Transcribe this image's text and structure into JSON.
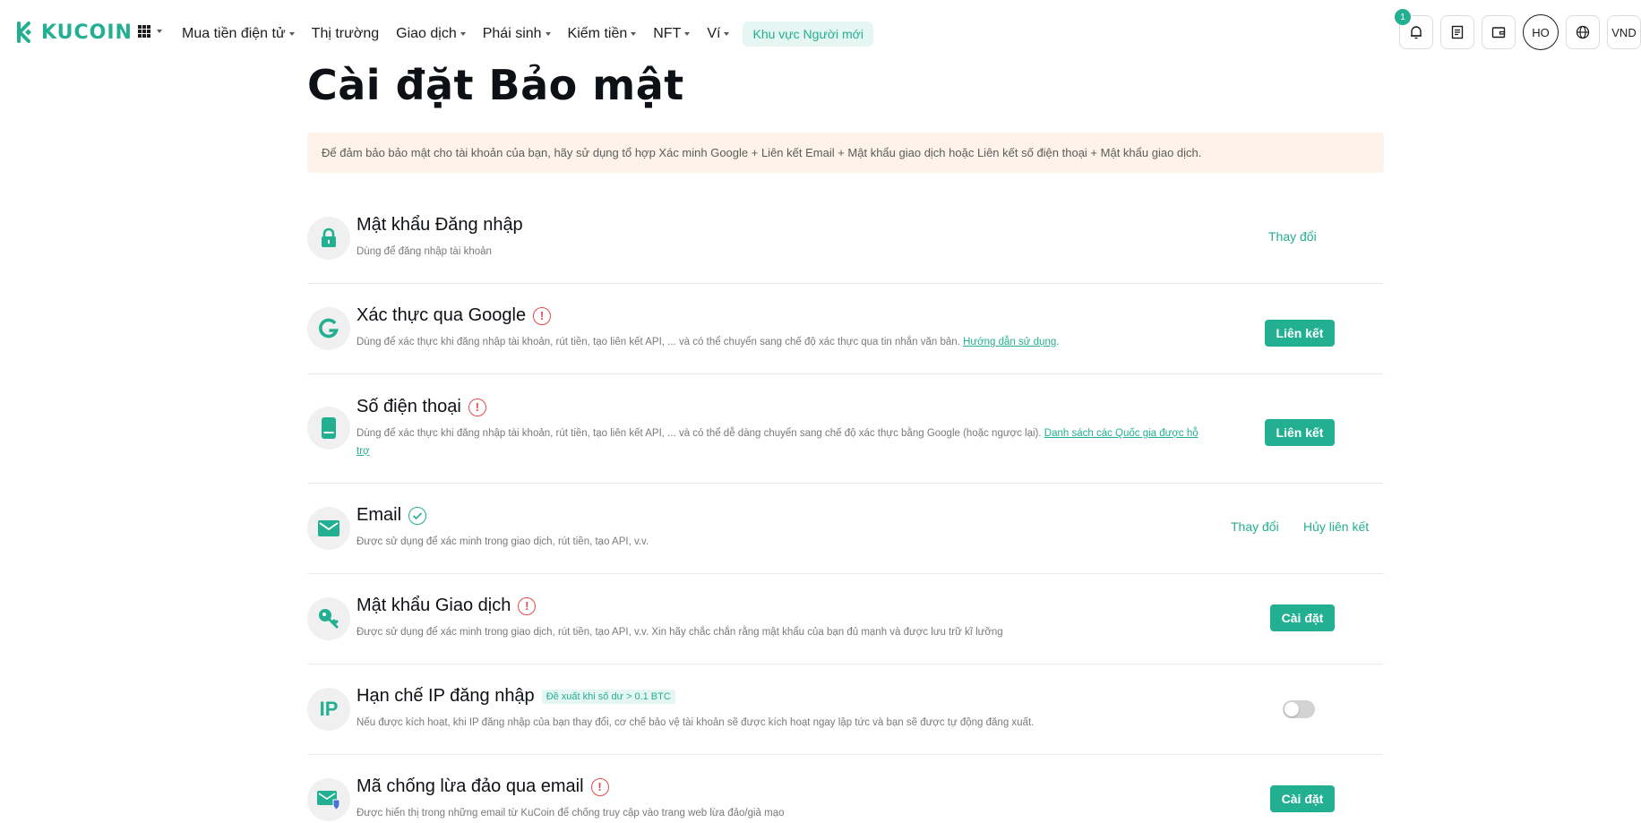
{
  "brand": {
    "name": "KUCOIN",
    "color": "#23af91"
  },
  "header": {
    "apps_icon": "apps-grid-icon",
    "nav": [
      {
        "label": "Mua tiền điện tử",
        "dropdown": true
      },
      {
        "label": "Thị trường",
        "dropdown": false
      },
      {
        "label": "Giao dịch",
        "dropdown": true
      },
      {
        "label": "Phái sinh",
        "dropdown": true
      },
      {
        "label": "Kiếm tiền",
        "dropdown": true
      },
      {
        "label": "NFT",
        "dropdown": true
      },
      {
        "label": "Ví",
        "dropdown": true
      }
    ],
    "newbie_zone": "Khu vực Người mới",
    "notification_count": "1",
    "avatar_initials": "HO",
    "currency": "VND"
  },
  "page": {
    "title": "Cài đặt Bảo mật",
    "notice": "Để đảm bảo bảo mật cho tài khoản của bạn, hãy sử dụng tổ hợp Xác minh Google + Liên kết Email + Mật khẩu giao dịch hoặc Liên kết số điện thoại + Mật khẩu giao dịch."
  },
  "settings": {
    "login_password": {
      "title": "Mật khẩu Đăng nhập",
      "desc": "Dùng để đăng nhập tài khoản",
      "action": "Thay đổi"
    },
    "google_auth": {
      "title": "Xác thực qua Google",
      "desc": "Dùng để xác thực khi đăng nhập tài khoản, rút tiền, tạo liên kết API, ... và có thể chuyển sang chế độ xác thực qua tin nhắn văn bản.",
      "link": "Hướng dẫn sử dụng",
      "desc_end": ".",
      "status": "warning",
      "action": "Liên kết"
    },
    "phone": {
      "title": "Số điện thoại",
      "desc": "Dùng để xác thực khi đăng nhập tài khoản, rút tiền, tạo liên kết API, ... và có thể dễ dàng chuyển sang chế độ xác thực bằng Google (hoặc ngược lại).",
      "link": "Danh sách các Quốc gia được hỗ trợ",
      "status": "warning",
      "action": "Liên kết"
    },
    "email": {
      "title": "Email",
      "desc": "Được sử dụng để xác minh trong giao dịch, rút tiền, tạo API, v.v.",
      "status": "verified",
      "action_change": "Thay đổi",
      "action_unlink": "Hủy liên kết"
    },
    "trade_password": {
      "title": "Mật khẩu Giao dịch",
      "desc": "Được sử dụng để xác minh trong giao dịch, rút tiền, tạo API, v.v. Xin hãy chắc chắn rằng mật khẩu của bạn đủ mạnh và được lưu trữ kĩ lưỡng",
      "status": "warning",
      "action": "Cài đặt"
    },
    "ip_restriction": {
      "icon_text": "IP",
      "title": "Hạn chế IP đăng nhập",
      "tag": "Đề xuất khi số dư > 0.1 BTC",
      "desc": "Nếu được kích hoạt, khi IP đăng nhập của bạn thay đổi, cơ chế bảo vệ tài khoản sẽ được kích hoạt ngay lập tức và bạn sẽ được tự động đăng xuất.",
      "toggle_on": false
    },
    "anti_phishing": {
      "title": "Mã chống lừa đảo qua email",
      "desc": "Được hiển thị trong những email từ KuCoin để chống truy cập vào trang web lừa đảo/giả mạo",
      "status": "warning",
      "action": "Cài đặt"
    }
  }
}
